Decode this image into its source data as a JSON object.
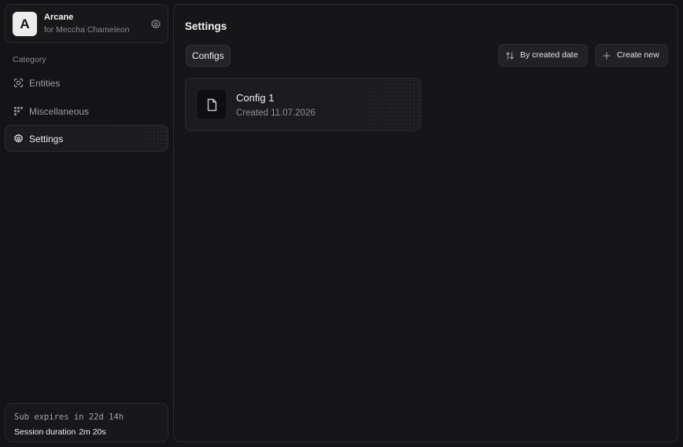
{
  "profile": {
    "avatar_letter": "A",
    "app_name": "Arcane",
    "subtitle": "for Meccha Chameleon",
    "settings_icon": "gear-icon"
  },
  "sidebar": {
    "category_label": "Category",
    "items": [
      {
        "label": "Entities",
        "icon": "scan-icon",
        "active": false
      },
      {
        "label": "Miscellaneous",
        "icon": "grid-icon",
        "active": false
      },
      {
        "label": "Settings",
        "icon": "gear-icon",
        "active": true
      }
    ]
  },
  "status": {
    "sub_expires": "Sub expires in 22d 14h",
    "session_label": "Session duration",
    "session_value": "2m 20s"
  },
  "main": {
    "title": "Settings",
    "tabs": [
      {
        "label": "Configs",
        "active": true
      }
    ],
    "sort_button": {
      "label": "By created date",
      "icon": "sort-arrows-icon"
    },
    "create_button": {
      "label": "Create new",
      "icon": "plus-icon"
    },
    "configs": [
      {
        "name": "Config 1",
        "created": "Created 11.07.2026",
        "icon": "file-icon"
      }
    ]
  },
  "colors": {
    "background": "#141416",
    "panel": "#161618",
    "card": "#1c1c1f",
    "border": "#2a2a2e",
    "text": "#f0f0f2",
    "muted": "#8a8a90"
  }
}
